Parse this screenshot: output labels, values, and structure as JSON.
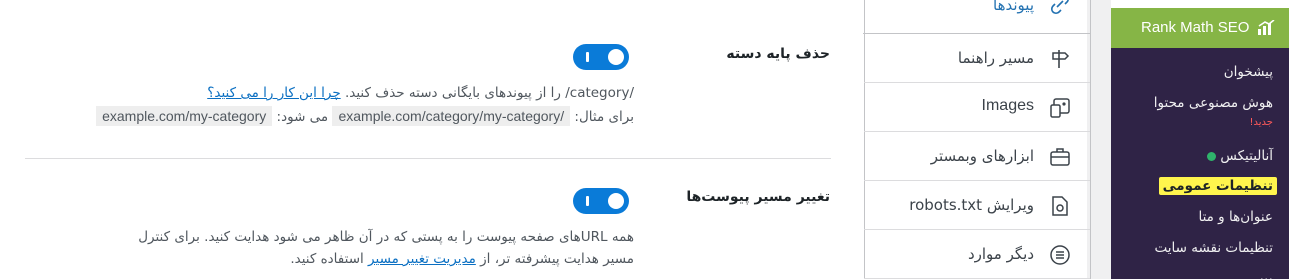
{
  "wp_sidebar": {
    "plugin_name": "Rank Math SEO",
    "items": [
      {
        "label": "پیشخوان"
      },
      {
        "label": "هوش مصنوعی محتوا"
      },
      {
        "label": "آنالیتیکس"
      },
      {
        "label": "تنظیمات عمومی"
      },
      {
        "label": "عنوان‌ها و متا"
      },
      {
        "label": "تنظیمات نقشه سایت"
      }
    ],
    "new_badge": "جدید!",
    "colors": {
      "header_bg": "#86b546",
      "submenu_bg": "#2f2346",
      "highlight": "#fff54d",
      "status_dot": "#2fb36b"
    }
  },
  "settings_nav": {
    "top_item": {
      "label": "پیوندها",
      "icon": "link-icon"
    },
    "items": [
      {
        "label": "مسیر راهنما",
        "icon": "signpost-icon"
      },
      {
        "label": "Images",
        "icon": "image-icon"
      },
      {
        "label": "ابزارهای وبمستر",
        "icon": "toolbox-icon"
      },
      {
        "label": "ویرایش robots.txt",
        "icon": "robots-file-icon"
      },
      {
        "label": "دیگر موارد",
        "icon": "list-circle-icon"
      }
    ]
  },
  "fields": [
    {
      "title": "حذف پایه دسته",
      "toggle_on": true,
      "desc_line1": "/category/ را از پیوندهای بایگانی دسته حذف کنید.",
      "desc_link": "چرا این کار را می کنید؟",
      "example_prefix": "برای مثال:",
      "example_before": "example.com/category/my-category/",
      "example_mid": "می شود:",
      "example_after": "example.com/my-category"
    },
    {
      "title": "تغییر مسیر پیوست‌ها",
      "toggle_on": true,
      "desc_line1": "همه URLهای صفحه پیوست را به پستی که در آن ظاهر می شود هدایت کنید. برای کنترل",
      "desc_line2_a": "مسیر هدایت پیشرفته تر، از",
      "desc_link": "مدیریت تغییر مسیر",
      "desc_line2_b": "استفاده کنید."
    }
  ],
  "toggle_color": "#0a7bd8"
}
